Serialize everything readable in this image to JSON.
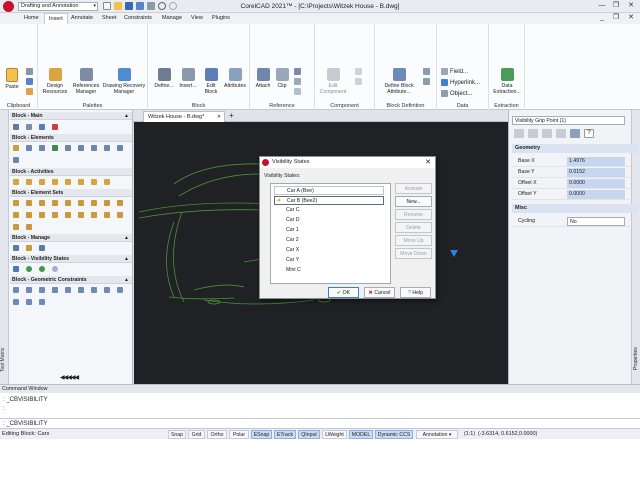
{
  "titlebar": {
    "workspace": "Drafting and Annotation",
    "title": "CorelCAD 2021™ - [C:\\Projects\\Witzek House - B.dwg]",
    "minimize": "—",
    "restore": "❐",
    "close": "✕",
    "doc_minimize": "_",
    "doc_restore": "❐",
    "doc_close": "✕"
  },
  "ribbon_tabs": [
    "Home",
    "Insert",
    "Annotate",
    "Sheet",
    "Constraints",
    "Manage",
    "View",
    "Plugins"
  ],
  "ribbon": {
    "clipboard": {
      "label": "Clipboard",
      "paste": "Paste"
    },
    "palettes": {
      "label": "Palettes",
      "design_resources": "Design\nResources",
      "references_manager": "References\nManager",
      "drawing_recovery": "Drawing Recovery\nManager"
    },
    "block": {
      "label": "Block",
      "define": "Define...",
      "insert": "Insert...",
      "edit_block": "Edit\nBlock",
      "attributes": "Attributes"
    },
    "reference": {
      "label": "Reference",
      "attach": "Attach",
      "clip": "Clip"
    },
    "component": {
      "label": "Component",
      "edit_component": "Edit\nComponent"
    },
    "block_definition": {
      "label": "Block Definition",
      "define_block_attribute": "Define Block\nAttribute..."
    },
    "data": {
      "label": "Data",
      "field": "Field...",
      "hyperlink": "Hyperlink...",
      "object": "Object..."
    },
    "extraction": {
      "label": "Extraction",
      "data_extraction": "Data\nExtraction..."
    }
  },
  "palette": {
    "strip_label": "Tool Matrix",
    "sections": [
      {
        "title": "Block - Main"
      },
      {
        "title": "Block - Elements"
      },
      {
        "title": "Block - Activities"
      },
      {
        "title": "Block - Element Sets"
      },
      {
        "title": "Block - Manage"
      },
      {
        "title": "Block - Visibility States"
      },
      {
        "title": "Block - Geometric Constraints"
      }
    ],
    "pager": "◀◀◀◀◀"
  },
  "doc_tab": {
    "label": "Witzek House - B.dwg*",
    "close": "✕",
    "add": "+"
  },
  "props": {
    "selector": "Visibility Grip Point (1)",
    "strip_label": "Properties",
    "geometry": {
      "title": "Geometry",
      "rows": [
        {
          "key": "Base X",
          "value": "1.4976"
        },
        {
          "key": "Base Y",
          "value": "0.0152"
        },
        {
          "key": "Offset X",
          "value": "0.0000"
        },
        {
          "key": "Offset Y",
          "value": "0.0000"
        }
      ]
    },
    "misc": {
      "title": "Misc",
      "rows": [
        {
          "key": "Cycling",
          "value": "No"
        }
      ]
    }
  },
  "dialog": {
    "title": "Visibility States",
    "list_label": "Visibility States:",
    "items": [
      "Car A (Bee)",
      "Car B (Bee2)",
      "Car C",
      "Car D",
      "Car 1",
      "Car 2",
      "Car X",
      "Car Y",
      "Mini C"
    ],
    "buttons": [
      "Activate",
      "New...",
      "Rename",
      "Delete",
      "Move Up",
      "Move Down"
    ],
    "ok": "OK",
    "cancel": "Cancel",
    "help": "Help"
  },
  "command": {
    "title": "Command Window",
    "lines": [
      ": _CBVISIBILITY",
      ":"
    ],
    "input": ": _CBVISIBILITY"
  },
  "status": {
    "left": "Editing Block: Cars",
    "toggles": [
      {
        "label": "Snap",
        "on": false
      },
      {
        "label": "Grid",
        "on": false
      },
      {
        "label": "Ortho",
        "on": false
      },
      {
        "label": "Polar",
        "on": false
      },
      {
        "label": "ESnap",
        "on": true
      },
      {
        "label": "ETrack",
        "on": true
      },
      {
        "label": "QInput",
        "on": true
      },
      {
        "label": "LWeight",
        "on": false
      },
      {
        "label": "MODEL",
        "on": true
      },
      {
        "label": "Dynamic CCS",
        "on": true
      }
    ],
    "annotation": "Annotation",
    "scale": "(1:1)",
    "coords": "(-3.6314, 0.6152,0.0000)"
  },
  "colors": {
    "accent": "#1b6fd1",
    "canvas": "#1f2125",
    "car_lines": "#4a8f3a",
    "grip": "#2f7fe0",
    "logo": "#c8102e"
  }
}
